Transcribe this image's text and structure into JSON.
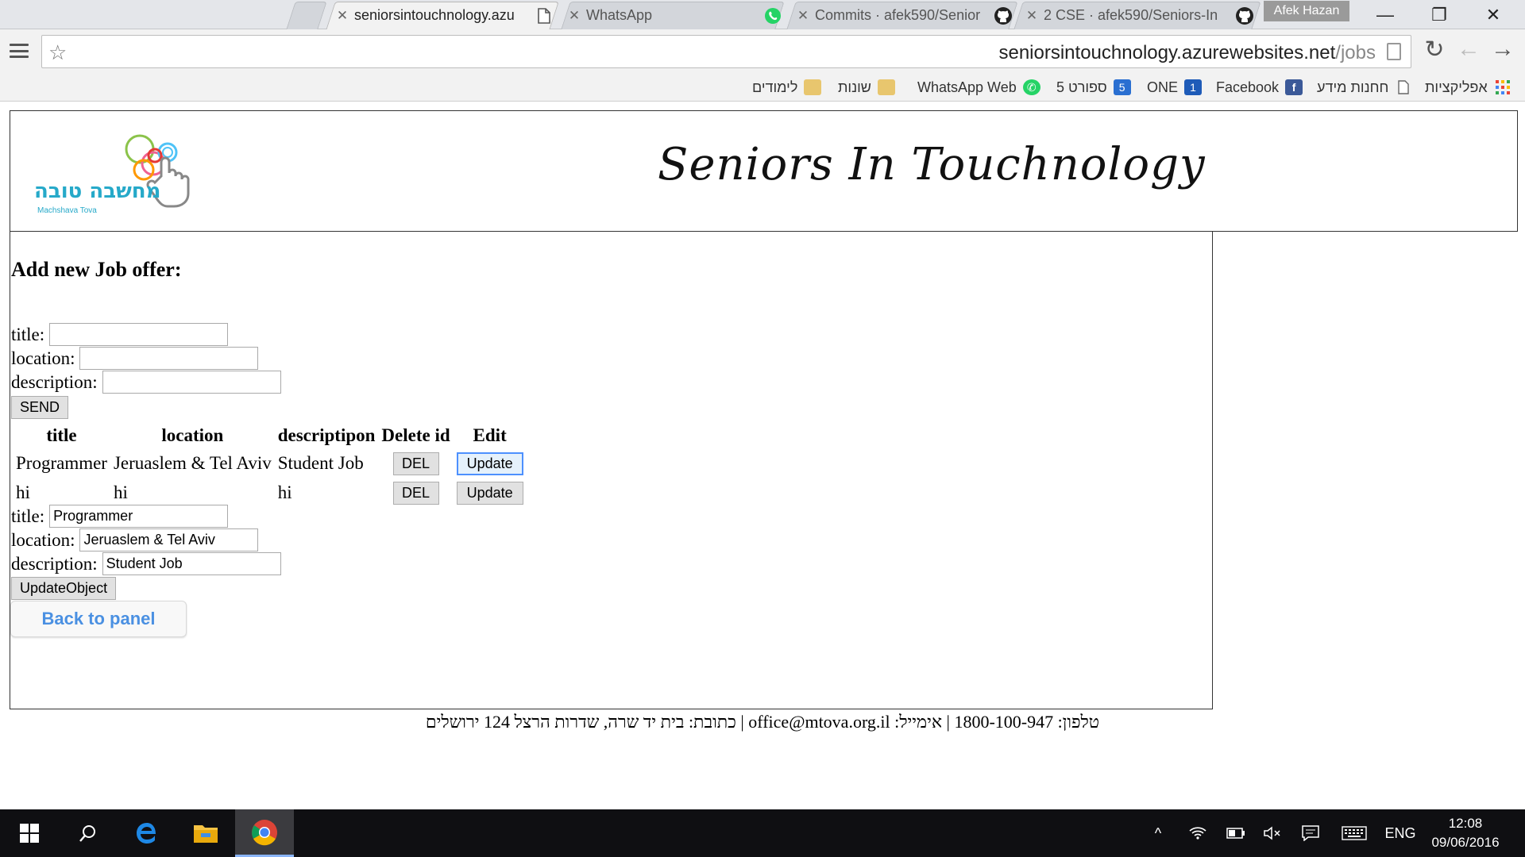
{
  "browser": {
    "tabs": [
      {
        "label": "seniorsintouchnology.azu",
        "active": true,
        "icon": "page-icon"
      },
      {
        "label": "WhatsApp",
        "active": false,
        "icon": "whatsapp-icon"
      },
      {
        "label": "Commits · afek590/Senior",
        "active": false,
        "icon": "github-icon"
      },
      {
        "label": "2 CSE · afek590/Seniors-In",
        "active": false,
        "icon": "github-icon"
      }
    ],
    "user_chip": "Afek Hazan",
    "url_host": "seniorsintouchnology.azurewebsites.net",
    "url_path": "/jobs",
    "bookmarks": [
      {
        "label": "אפליקציות",
        "icon": "apps-grid-icon"
      },
      {
        "label": "חחנות מידע",
        "icon": "page-icon"
      },
      {
        "label": "Facebook",
        "icon": "facebook-icon"
      },
      {
        "label": "ONE",
        "icon": "one-icon"
      },
      {
        "label": "ספורט 5",
        "icon": "sport5-icon"
      },
      {
        "label": "WhatsApp Web",
        "icon": "whatsapp-icon"
      },
      {
        "label": "שונות",
        "icon": "folder-icon"
      },
      {
        "label": "לימודים",
        "icon": "folder-icon"
      }
    ]
  },
  "site": {
    "logo_text_he": "מחשבה טובה",
    "logo_text_en": "Machshava Tova",
    "title": "Seniors In Touchnology"
  },
  "form_add": {
    "heading": "Add new Job offer:",
    "title_label": "title:",
    "location_label": "location:",
    "description_label": "description:",
    "title_value": "",
    "location_value": "",
    "description_value": "",
    "send_label": "SEND"
  },
  "jobs_table": {
    "headers": [
      "title",
      "location",
      "descriptipon",
      "Delete id",
      "Edit"
    ],
    "rows": [
      {
        "title": "Programmer",
        "location": "Jeruaslem & Tel Aviv",
        "description": "Student Job",
        "del_label": "DEL",
        "edit_label": "Update"
      },
      {
        "title": "hi",
        "location": "hi",
        "description": "hi",
        "del_label": "DEL",
        "edit_label": "Update"
      }
    ]
  },
  "form_update": {
    "title_label": "title:",
    "location_label": "location:",
    "description_label": "description:",
    "title_value": "Programmer",
    "location_value": "Jeruaslem & Tel Aviv",
    "description_value": "Student Job",
    "submit_label": "UpdateObject"
  },
  "back_label": "Back to panel",
  "footer": "טלפון: 1800-100-947 | אימייל: office@mtova.org.il | כתובת: בית יד שרה, שדרות הרצל 124 ירושלים",
  "taskbar": {
    "lang": "ENG",
    "time": "12:08",
    "date": "09/06/2016"
  },
  "colors": {
    "link_blue": "#4a90e2",
    "taskbar_bg": "#0f0f12",
    "chrome_bg": "#f2f2f2"
  }
}
